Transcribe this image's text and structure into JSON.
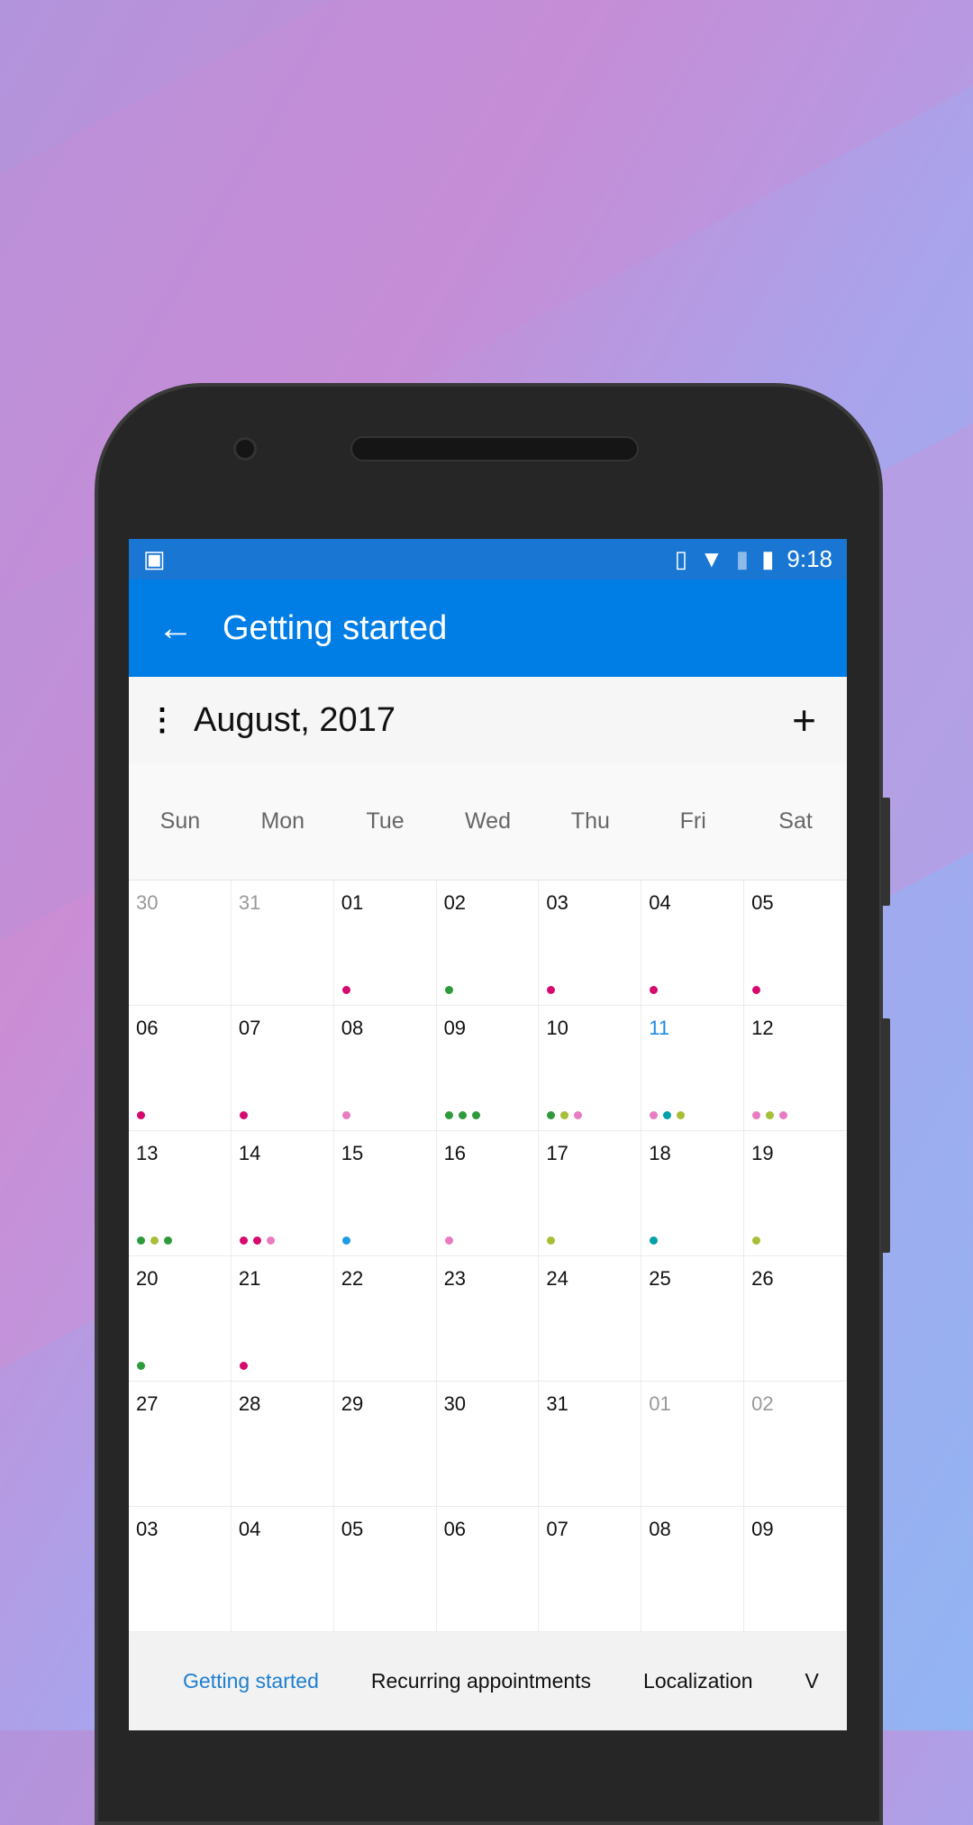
{
  "status_bar": {
    "time": "9:18",
    "icons": [
      "image-icon",
      "vibrate-icon",
      "wifi-icon",
      "no-sim-icon",
      "battery-icon"
    ]
  },
  "toolbar": {
    "title": "Getting started",
    "back_icon": "arrow-left-icon"
  },
  "header": {
    "month": "August, 2017",
    "menu_icon": "more-vert-icon",
    "add_icon": "plus-icon"
  },
  "weekdays": [
    "Sun",
    "Mon",
    "Tue",
    "Wed",
    "Thu",
    "Fri",
    "Sat"
  ],
  "colors": {
    "magenta": "#d6096e",
    "green": "#2e9a3c",
    "lime": "#a6bf36",
    "pink": "#e97cc0",
    "teal": "#00a0a8",
    "blue": "#1d9be6",
    "accent": "#007ee5"
  },
  "days": [
    {
      "n": "30",
      "other": true,
      "dots": []
    },
    {
      "n": "31",
      "other": true,
      "dots": []
    },
    {
      "n": "01",
      "dots": [
        "magenta"
      ]
    },
    {
      "n": "02",
      "dots": [
        "green"
      ]
    },
    {
      "n": "03",
      "dots": [
        "magenta"
      ]
    },
    {
      "n": "04",
      "dots": [
        "magenta"
      ]
    },
    {
      "n": "05",
      "dots": [
        "magenta"
      ]
    },
    {
      "n": "06",
      "dots": [
        "magenta"
      ]
    },
    {
      "n": "07",
      "dots": [
        "magenta"
      ]
    },
    {
      "n": "08",
      "dots": [
        "pink"
      ]
    },
    {
      "n": "09",
      "dots": [
        "green",
        "green",
        "green"
      ]
    },
    {
      "n": "10",
      "dots": [
        "green",
        "lime",
        "pink"
      ]
    },
    {
      "n": "11",
      "today": true,
      "dots": [
        "pink",
        "teal",
        "lime"
      ]
    },
    {
      "n": "12",
      "dots": [
        "pink",
        "lime",
        "pink"
      ]
    },
    {
      "n": "13",
      "dots": [
        "green",
        "lime",
        "green"
      ]
    },
    {
      "n": "14",
      "dots": [
        "magenta",
        "magenta",
        "pink"
      ]
    },
    {
      "n": "15",
      "dots": [
        "blue"
      ]
    },
    {
      "n": "16",
      "dots": [
        "pink"
      ]
    },
    {
      "n": "17",
      "dots": [
        "lime"
      ]
    },
    {
      "n": "18",
      "dots": [
        "teal"
      ]
    },
    {
      "n": "19",
      "dots": [
        "lime"
      ]
    },
    {
      "n": "20",
      "dots": [
        "green"
      ]
    },
    {
      "n": "21",
      "dots": [
        "magenta"
      ]
    },
    {
      "n": "22",
      "dots": []
    },
    {
      "n": "23",
      "dots": []
    },
    {
      "n": "24",
      "dots": []
    },
    {
      "n": "25",
      "dots": []
    },
    {
      "n": "26",
      "dots": []
    },
    {
      "n": "27",
      "dots": []
    },
    {
      "n": "28",
      "dots": []
    },
    {
      "n": "29",
      "dots": []
    },
    {
      "n": "30",
      "dots": []
    },
    {
      "n": "31",
      "dots": []
    },
    {
      "n": "01",
      "other": true,
      "dots": []
    },
    {
      "n": "02",
      "other": true,
      "dots": []
    },
    {
      "n": "03",
      "dots": []
    },
    {
      "n": "04",
      "dots": []
    },
    {
      "n": "05",
      "dots": []
    },
    {
      "n": "06",
      "dots": []
    },
    {
      "n": "07",
      "dots": []
    },
    {
      "n": "08",
      "dots": []
    },
    {
      "n": "09",
      "dots": []
    }
  ],
  "tabs": [
    {
      "label": "Getting started",
      "active": true
    },
    {
      "label": "Recurring appointments"
    },
    {
      "label": "Localization"
    },
    {
      "label": "V"
    }
  ]
}
